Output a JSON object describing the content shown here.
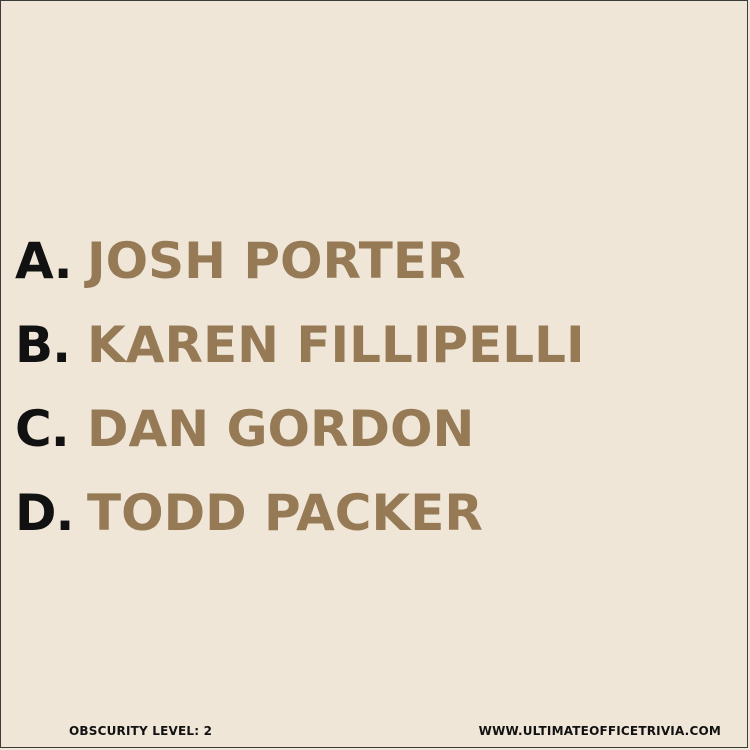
{
  "answers": [
    {
      "letter": "A.",
      "text": "JOSH PORTER"
    },
    {
      "letter": "B.",
      "text": "KAREN FILLIPELLI"
    },
    {
      "letter": "C.",
      "text": "DAN GORDON"
    },
    {
      "letter": "D.",
      "text": "TODD PACKER"
    }
  ],
  "footer": {
    "obscurity": "OBSCURITY LEVEL: 2",
    "website": "WWW.ULTIMATEOFFICETRIVIA.COM"
  },
  "colors": {
    "background": "#f0e6d8",
    "letter": "#111111",
    "answer": "#967a56"
  }
}
